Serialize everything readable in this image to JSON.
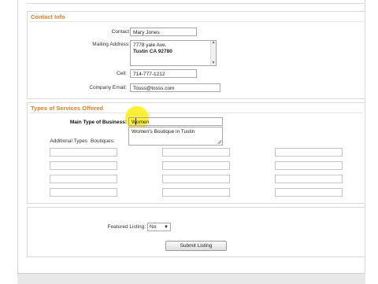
{
  "contact": {
    "legend": "Contact Info",
    "contact_name_label": "Contact Name:",
    "contact_name_value": "Mary Jones",
    "mailing_address_label": "Mailing Address:",
    "mailing_address_line1": "7778 yale Ave.",
    "mailing_address_line2": "Tustin CA 92780",
    "cell_label": "Cell:",
    "cell_value": "714-777-1212",
    "company_email_label": "Company Email:",
    "company_email_value": "Tosss@tosss.com"
  },
  "services": {
    "legend": "Types of Services Offered",
    "main_type_label": "Main Type of Business:",
    "main_type_value": "Women",
    "description_value": "Women's Boutique in Tustin",
    "additional_types_label": "Additional Types",
    "additional_types_sub": "Boutiques:"
  },
  "featured": {
    "label": "Featured Listing:",
    "selected": "No"
  },
  "submit": {
    "label": "Submit Listing"
  },
  "colors": {
    "legend": "#e0822a",
    "highlight": "#ffef2a"
  }
}
